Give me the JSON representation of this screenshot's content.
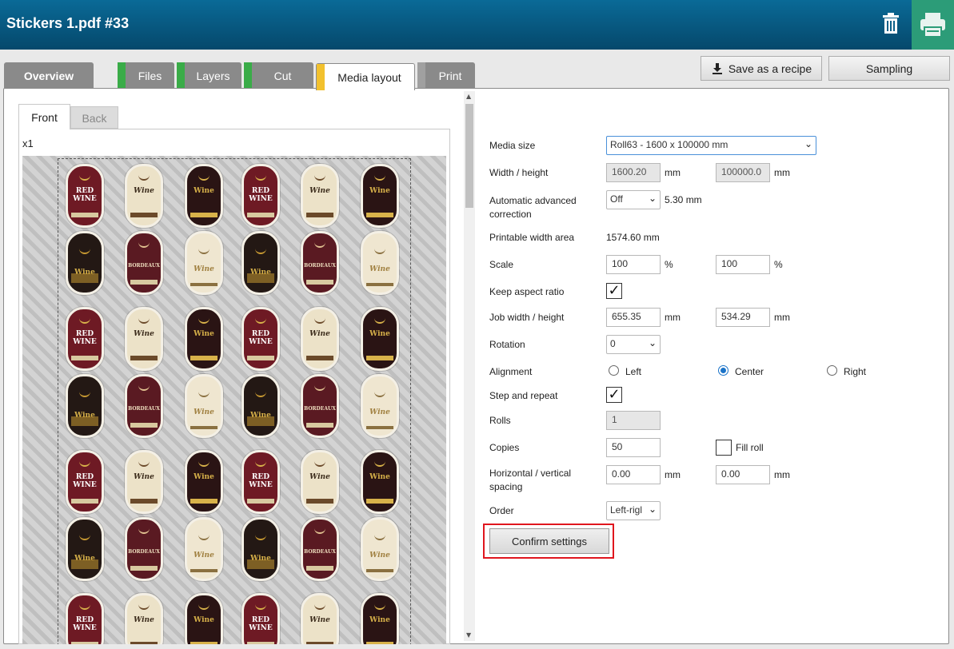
{
  "header": {
    "title": "Stickers 1.pdf #33",
    "trash_icon": "trash-icon",
    "print_icon": "printer-icon",
    "print_bg": "#2c9c78"
  },
  "tabs": [
    {
      "label": "Overview",
      "status_color": ""
    },
    {
      "label": "Files",
      "status_color": "#3aac48"
    },
    {
      "label": "Layers",
      "status_color": "#3aac48"
    },
    {
      "label": "Cut",
      "status_color": "#3aac48"
    },
    {
      "label": "Media layout",
      "status_color": "#f2c12e",
      "active": true
    },
    {
      "label": "Print",
      "status_color": "#8a8a8a"
    }
  ],
  "actions": {
    "save_recipe": "Save as a recipe",
    "sampling": "Sampling"
  },
  "preview": {
    "side_tabs": [
      "Front",
      "Back"
    ],
    "multiplier": "x1",
    "label_texts": {
      "red": "RED WINE",
      "cream": "Wine",
      "dark": "Wine",
      "grape": "Wine",
      "bordeaux": "BORDEAUX",
      "collection": "Wine"
    }
  },
  "settings": {
    "media_size": {
      "label": "Media size",
      "value": "Roll63 - 1600 x 100000 mm"
    },
    "width_height": {
      "label": "Width / height",
      "width": "1600.20",
      "height": "100000.0",
      "unit": "mm"
    },
    "auto_correction": {
      "label": "Automatic advanced correction",
      "value": "Off",
      "extra": "5.30 mm"
    },
    "printable_width": {
      "label": "Printable width area",
      "value": "1574.60 mm"
    },
    "scale": {
      "label": "Scale",
      "x": "100",
      "y": "100",
      "unit": "%"
    },
    "keep_aspect": {
      "label": "Keep aspect ratio",
      "checked": "✓"
    },
    "job_size": {
      "label": "Job width / height",
      "width": "655.35",
      "height": "534.29",
      "unit": "mm"
    },
    "rotation": {
      "label": "Rotation",
      "value": "0"
    },
    "alignment": {
      "label": "Alignment",
      "options": [
        "Left",
        "Center",
        "Right"
      ],
      "selected": "Center"
    },
    "step_repeat": {
      "label": "Step and repeat",
      "checked": "✓"
    },
    "rolls": {
      "label": "Rolls",
      "value": "1"
    },
    "copies": {
      "label": "Copies",
      "value": "50",
      "fill_roll": "Fill roll"
    },
    "spacing": {
      "label": "Horizontal / vertical spacing",
      "h": "0.00",
      "v": "0.00",
      "unit": "mm"
    },
    "order": {
      "label": "Order",
      "value": "Left-rigl"
    },
    "confirm": "Confirm settings"
  }
}
